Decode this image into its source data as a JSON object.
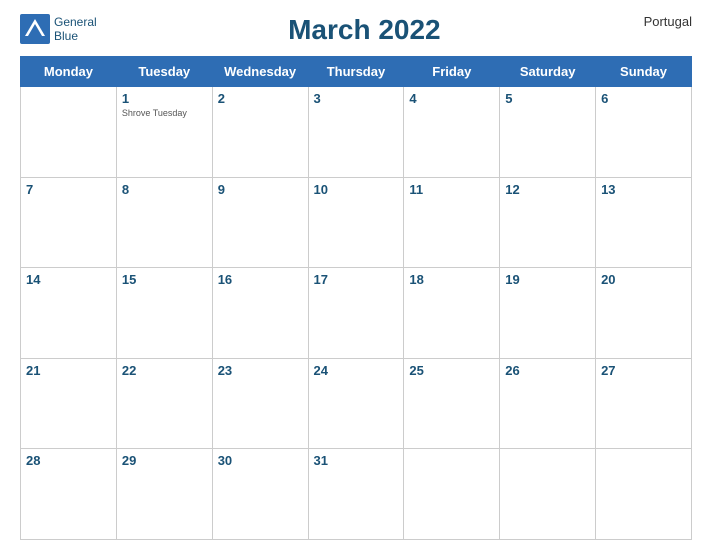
{
  "header": {
    "title": "March 2022",
    "country": "Portugal",
    "logo_top": "General",
    "logo_bottom": "Blue"
  },
  "days_of_week": [
    "Monday",
    "Tuesday",
    "Wednesday",
    "Thursday",
    "Friday",
    "Saturday",
    "Sunday"
  ],
  "weeks": [
    [
      {
        "num": "",
        "holiday": ""
      },
      {
        "num": "1",
        "holiday": "Shrove Tuesday"
      },
      {
        "num": "2",
        "holiday": ""
      },
      {
        "num": "3",
        "holiday": ""
      },
      {
        "num": "4",
        "holiday": ""
      },
      {
        "num": "5",
        "holiday": ""
      },
      {
        "num": "6",
        "holiday": ""
      }
    ],
    [
      {
        "num": "7",
        "holiday": ""
      },
      {
        "num": "8",
        "holiday": ""
      },
      {
        "num": "9",
        "holiday": ""
      },
      {
        "num": "10",
        "holiday": ""
      },
      {
        "num": "11",
        "holiday": ""
      },
      {
        "num": "12",
        "holiday": ""
      },
      {
        "num": "13",
        "holiday": ""
      }
    ],
    [
      {
        "num": "14",
        "holiday": ""
      },
      {
        "num": "15",
        "holiday": ""
      },
      {
        "num": "16",
        "holiday": ""
      },
      {
        "num": "17",
        "holiday": ""
      },
      {
        "num": "18",
        "holiday": ""
      },
      {
        "num": "19",
        "holiday": ""
      },
      {
        "num": "20",
        "holiday": ""
      }
    ],
    [
      {
        "num": "21",
        "holiday": ""
      },
      {
        "num": "22",
        "holiday": ""
      },
      {
        "num": "23",
        "holiday": ""
      },
      {
        "num": "24",
        "holiday": ""
      },
      {
        "num": "25",
        "holiday": ""
      },
      {
        "num": "26",
        "holiday": ""
      },
      {
        "num": "27",
        "holiday": ""
      }
    ],
    [
      {
        "num": "28",
        "holiday": ""
      },
      {
        "num": "29",
        "holiday": ""
      },
      {
        "num": "30",
        "holiday": ""
      },
      {
        "num": "31",
        "holiday": ""
      },
      {
        "num": "",
        "holiday": ""
      },
      {
        "num": "",
        "holiday": ""
      },
      {
        "num": "",
        "holiday": ""
      }
    ]
  ]
}
